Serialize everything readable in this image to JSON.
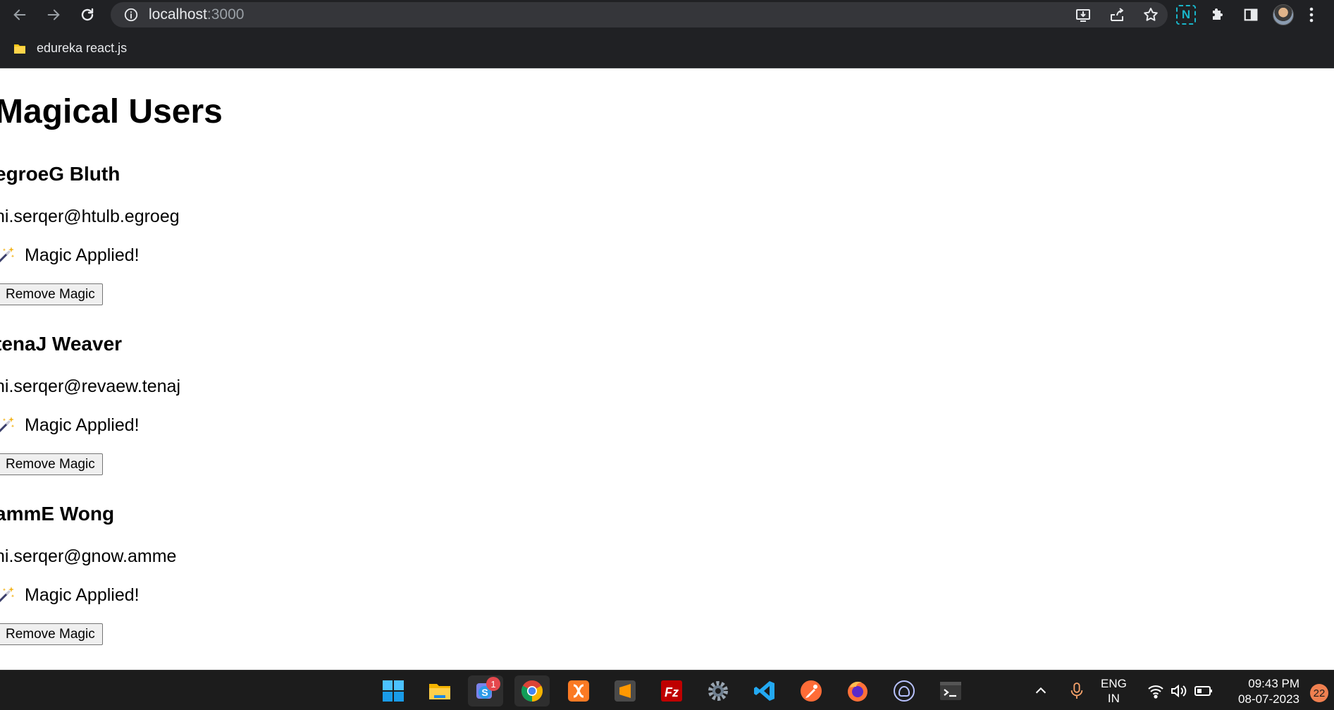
{
  "browser": {
    "url_host": "localhost",
    "url_port": ":3000",
    "bookmark_label": "edureka react.js",
    "extension_label": "N"
  },
  "page": {
    "title": "Magical Users",
    "users": [
      {
        "name": "egroeG Bluth",
        "email": "ni.serqer@htulb.egroeg",
        "status": "Magic Applied!",
        "button": "Remove Magic"
      },
      {
        "name": "tenaJ Weaver",
        "email": "ni.serqer@revaew.tenaj",
        "status": "Magic Applied!",
        "button": "Remove Magic"
      },
      {
        "name": "ammE Wong",
        "email": "ni.serqer@gnow.amme",
        "status": "Magic Applied!",
        "button": "Remove Magic"
      }
    ]
  },
  "taskbar": {
    "teams_badge": "1",
    "language_line1": "ENG",
    "language_line2": "IN",
    "time": "09:43 PM",
    "date": "08-07-2023",
    "notification_count": "22",
    "apps": [
      "start-icon",
      "file-explorer-icon",
      "teams-icon",
      "chrome-icon",
      "xampp-icon",
      "sublime-icon",
      "filezilla-icon",
      "settings-icon",
      "vscode-icon",
      "postman-icon",
      "firefox-icon",
      "github-desktop-icon",
      "terminal-icon"
    ]
  },
  "colors": {
    "chrome_bg": "#202124",
    "omnibox_bg": "#35363a",
    "taskbar_bg": "#1c1c1c",
    "button_bg": "#efefef",
    "extension_accent": "#19b5c9"
  }
}
